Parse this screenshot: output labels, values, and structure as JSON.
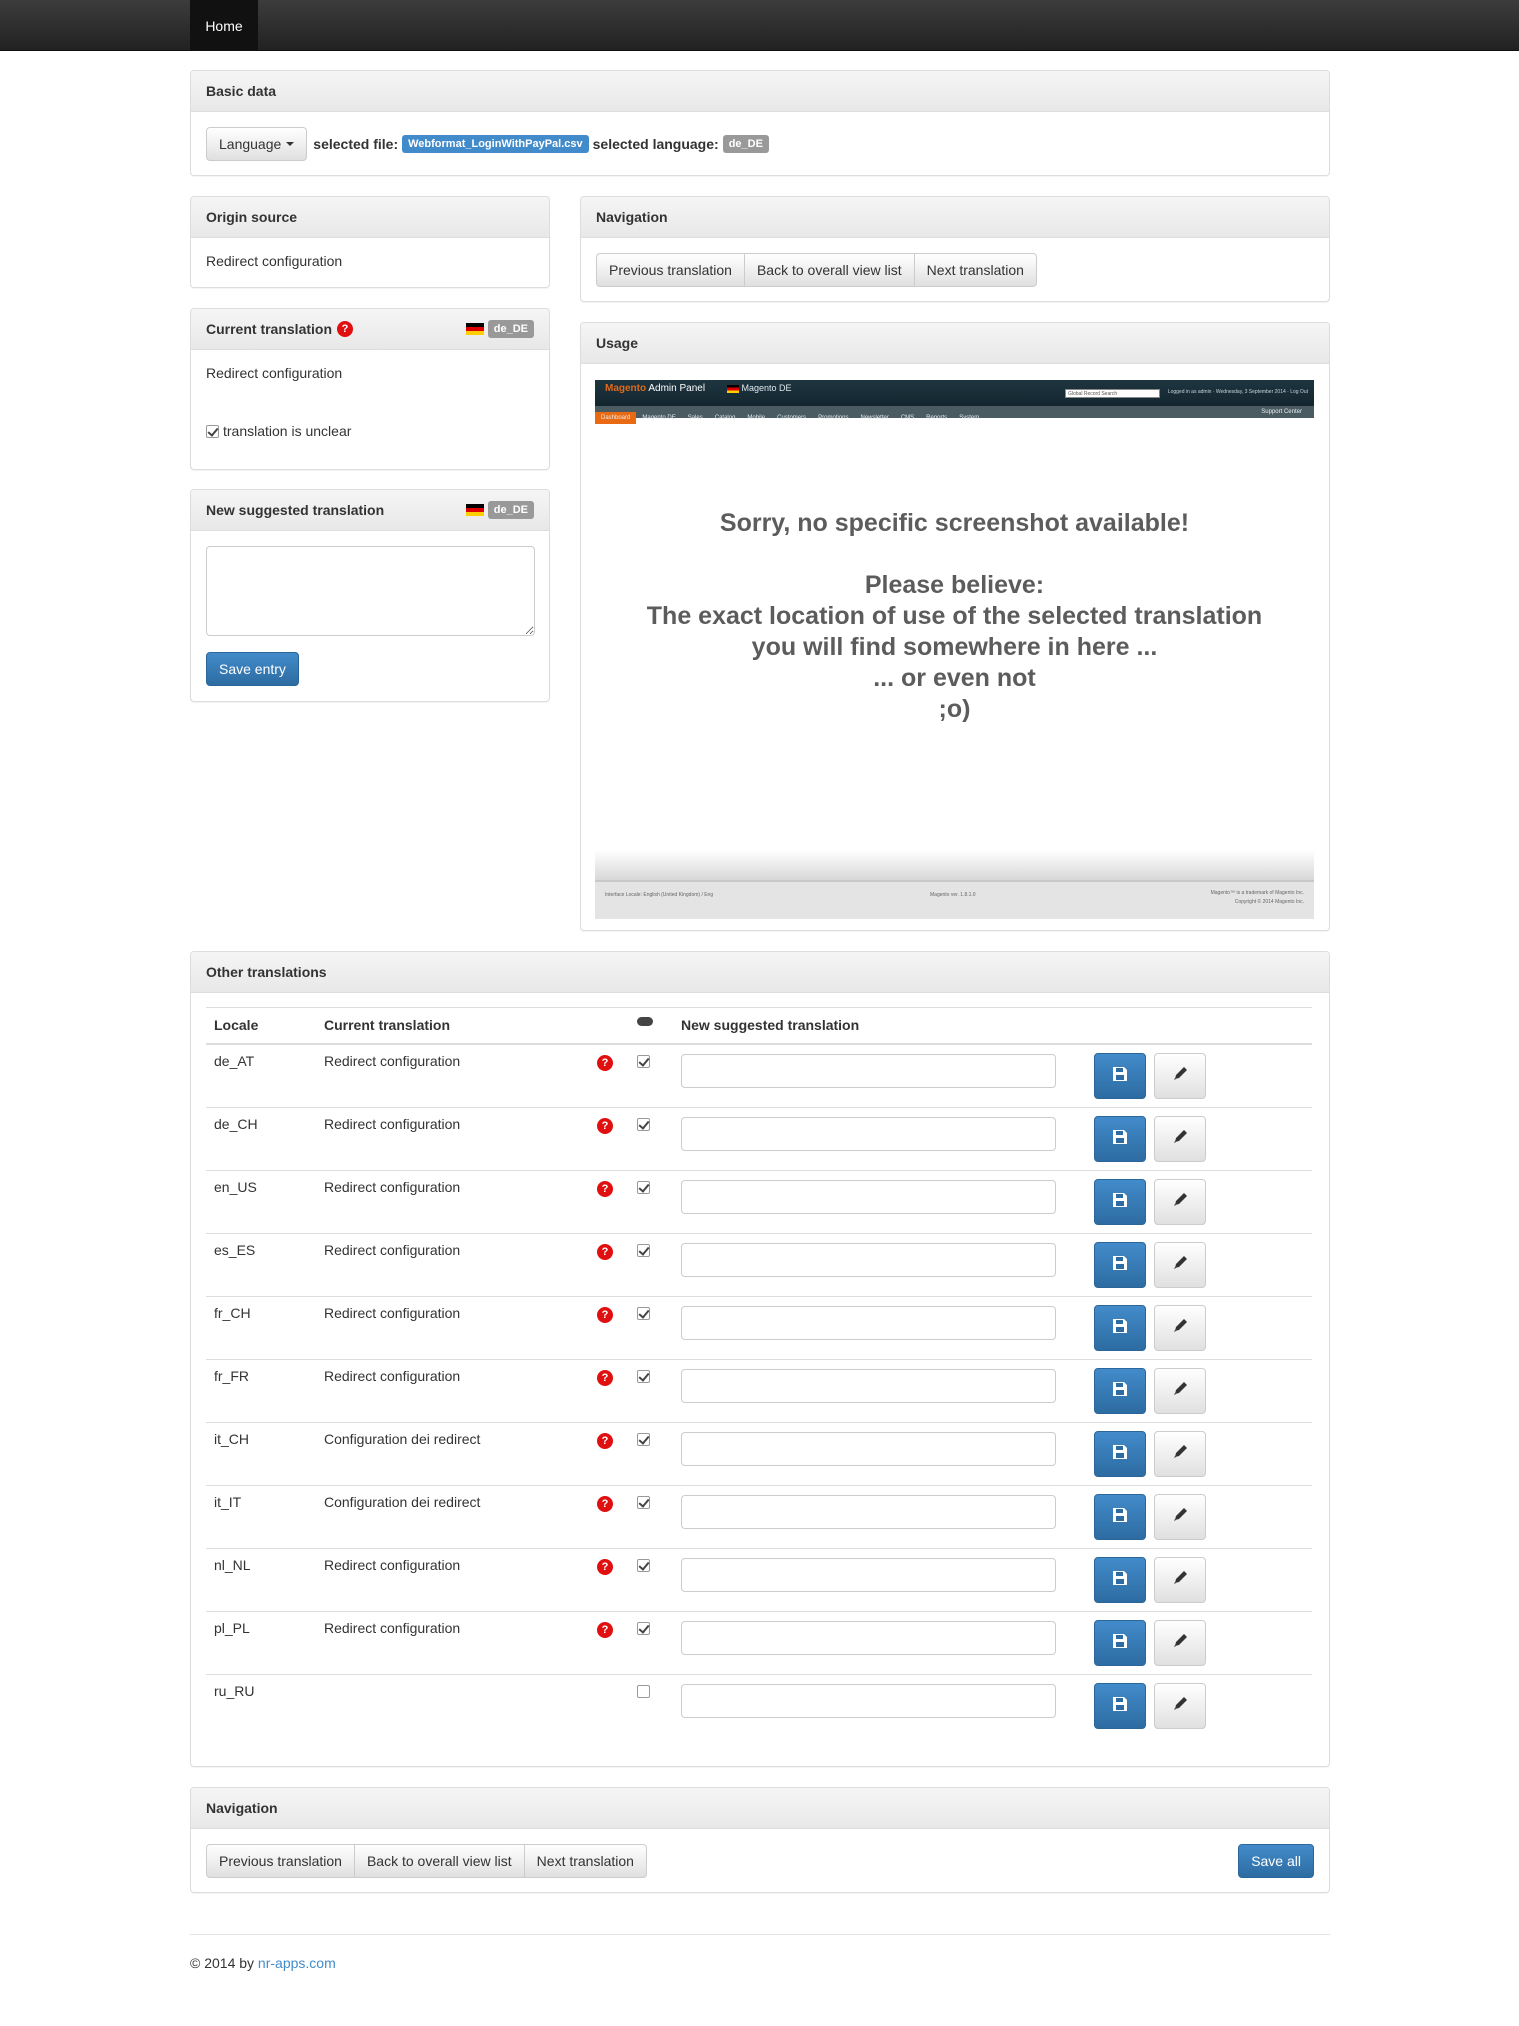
{
  "navbar": {
    "home_label": "Home"
  },
  "basic_data": {
    "heading": "Basic data",
    "language_button": "Language",
    "selected_file_label": "selected file:",
    "selected_file": "Webformat_LoginWithPayPal.csv",
    "selected_language_label": "selected language:",
    "selected_language": "de_DE"
  },
  "origin_source": {
    "heading": "Origin source",
    "text": "Redirect configuration"
  },
  "current_translation": {
    "heading": "Current translation",
    "locale_badge": "de_DE",
    "text": "Redirect configuration",
    "unclear_label": "translation is unclear",
    "unclear_checked": true
  },
  "new_suggested": {
    "heading": "New suggested translation",
    "locale_badge": "de_DE",
    "textarea_value": "",
    "save_button": "Save entry"
  },
  "navigation_top": {
    "heading": "Navigation",
    "prev": "Previous translation",
    "back": "Back to overall view list",
    "next": "Next translation"
  },
  "usage": {
    "heading": "Usage",
    "shot": {
      "logo_brand": "Magento",
      "logo_text": "Admin Panel",
      "locale_label": "Magento DE",
      "search_placeholder": "Global Record Search",
      "login_info": "Logged in as admin  ·  Wednesday, 3 September 2014  ·  Log Out",
      "menu": [
        "Dashboard",
        "Magento DE",
        "Sales",
        "Catalog",
        "Mobile",
        "Customers",
        "Promotions",
        "Newsletter",
        "CMS",
        "Reports",
        "System"
      ],
      "support": "Support Center",
      "message_lines": [
        "Sorry, no specific screenshot available!",
        "",
        "Please believe:",
        "The exact location of use of the selected translation",
        "you will find somewhere in here ...",
        "... or even not",
        ";o)"
      ],
      "footer_locale": "Interface Locale: English (United Kingdom) / Eng",
      "footer_version": "Magento ver. 1.8.1.0",
      "footer_trademark": "Magento™ is a trademark of Magento Inc.",
      "footer_copyright": "Copyright © 2014 Magento Inc."
    }
  },
  "other_translations": {
    "heading": "Other translations",
    "columns": {
      "locale": "Locale",
      "current": "Current translation",
      "new": "New suggested translation"
    },
    "rows": [
      {
        "locale": "de_AT",
        "current": "Redirect configuration",
        "help": true,
        "checked": true,
        "value": ""
      },
      {
        "locale": "de_CH",
        "current": "Redirect configuration",
        "help": true,
        "checked": true,
        "value": ""
      },
      {
        "locale": "en_US",
        "current": "Redirect configuration",
        "help": true,
        "checked": true,
        "value": ""
      },
      {
        "locale": "es_ES",
        "current": "Redirect configuration",
        "help": true,
        "checked": true,
        "value": ""
      },
      {
        "locale": "fr_CH",
        "current": "Redirect configuration",
        "help": true,
        "checked": true,
        "value": ""
      },
      {
        "locale": "fr_FR",
        "current": "Redirect configuration",
        "help": true,
        "checked": true,
        "value": ""
      },
      {
        "locale": "it_CH",
        "current": "Configuration dei redirect",
        "help": true,
        "checked": true,
        "value": ""
      },
      {
        "locale": "it_IT",
        "current": "Configuration dei redirect",
        "help": true,
        "checked": true,
        "value": ""
      },
      {
        "locale": "nl_NL",
        "current": "Redirect configuration",
        "help": true,
        "checked": true,
        "value": ""
      },
      {
        "locale": "pl_PL",
        "current": "Redirect configuration",
        "help": true,
        "checked": true,
        "value": ""
      },
      {
        "locale": "ru_RU",
        "current": "",
        "help": false,
        "checked": false,
        "value": ""
      }
    ]
  },
  "navigation_bottom": {
    "heading": "Navigation",
    "prev": "Previous translation",
    "back": "Back to overall view list",
    "next": "Next translation",
    "save_all": "Save all"
  },
  "footer": {
    "prefix": "© 2014 by",
    "link": "nr-apps.com"
  },
  "colors": {
    "primary": "#428bca",
    "help_red": "#e01010",
    "badge_grey": "#999999"
  }
}
